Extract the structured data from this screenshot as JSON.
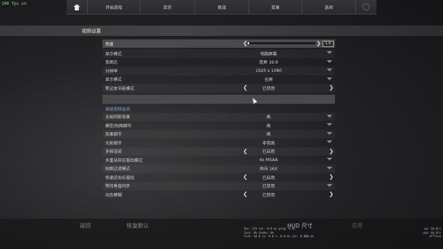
{
  "fps": "100 fps on",
  "nav": {
    "items": [
      "开始游戏",
      "库存",
      "观战",
      "奖章",
      "选项"
    ]
  },
  "section_title": "视频设置",
  "brightness": {
    "label": "亮度",
    "value": "1.6",
    "level": 0.02
  },
  "rows_top": [
    {
      "label": "显示模式",
      "value": "电脑屏幕",
      "control": "dropdown"
    },
    {
      "label": "宽高比",
      "value": "宽屏 16:9",
      "control": "dropdown"
    },
    {
      "label": "分辨率",
      "value": "1920 x 1080",
      "control": "dropdown"
    },
    {
      "label": "显示模式",
      "value": "全屏",
      "control": "dropdown"
    },
    {
      "label": "笔记本节能模式",
      "value": "已禁用",
      "control": "arrows"
    }
  ],
  "advanced_title": "高级视频选项",
  "rows_adv": [
    {
      "label": "全局阴影效果",
      "value": "高",
      "control": "dropdown"
    },
    {
      "label": "模型/贴图细节",
      "value": "高",
      "control": "dropdown"
    },
    {
      "label": "效果细节",
      "value": "高",
      "control": "dropdown"
    },
    {
      "label": "光影细节",
      "value": "非常高",
      "control": "dropdown"
    },
    {
      "label": "多核渲染",
      "value": "已启用",
      "control": "arrows"
    },
    {
      "label": "多重采样抗锯齿模式",
      "value": "4x MSAA",
      "control": "dropdown"
    },
    {
      "label": "贴图过滤模式",
      "value": "异向 16X",
      "control": "dropdown"
    },
    {
      "label": "快速近似抗锯齿",
      "value": "已启用",
      "control": "arrows"
    },
    {
      "label": "等待垂直同步",
      "value": "已禁用",
      "control": "dropdown"
    },
    {
      "label": "动态模糊",
      "value": "已禁用",
      "control": "arrows"
    }
  ],
  "footer": {
    "back": "返回",
    "reset": "恢复默认",
    "hud": "HUD 尺寸",
    "apply": "应用",
    "net_left": [
      "fps:   119  var:  0.0 ms  ping: 0 ms",
      "loss:  0%  choke:  0%",
      "tick: 64.0  sv:  0.0 +- 0.0 ms   var:  0.000 ms"
    ],
    "net_right": [
      "up: 64.0/s",
      "cmd: 64.0/s",
      "offline"
    ]
  }
}
